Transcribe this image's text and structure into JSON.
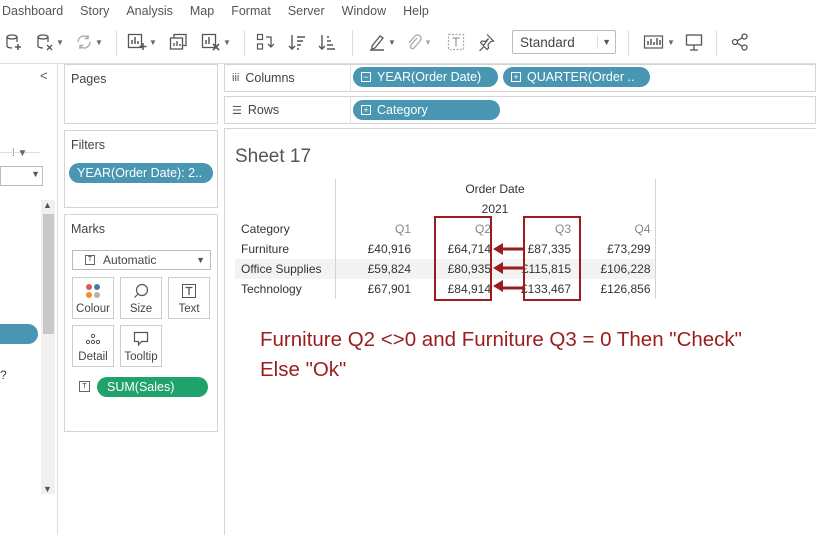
{
  "menu": [
    "Dashboard",
    "Story",
    "Analysis",
    "Map",
    "Format",
    "Server",
    "Window",
    "Help"
  ],
  "toolbar": {
    "fit_value": "Standard"
  },
  "panels": {
    "pages_title": "Pages",
    "filters_title": "Filters",
    "filter_pill": "YEAR(Order Date): 2..",
    "marks_title": "Marks",
    "mark_type": "Automatic",
    "mark_buttons": [
      "Colour",
      "Size",
      "Text",
      "Detail",
      "Tooltip"
    ],
    "sum_pill": "SUM(Sales)"
  },
  "left_pane": {
    "fragment": "?"
  },
  "shelves": {
    "columns_label": "Columns",
    "rows_label": "Rows",
    "columns_pills": [
      "YEAR(Order Date)",
      "QUARTER(Order .."
    ],
    "rows_pills": [
      "Category"
    ]
  },
  "sheet": {
    "title": "Sheet 17",
    "header_top": "Order Date",
    "header_year": "2021",
    "row_header_label": "Category",
    "quarters": [
      "Q1",
      "Q2",
      "Q3",
      "Q4"
    ],
    "rows": [
      {
        "category": "Furniture",
        "values": [
          "£40,916",
          "£64,714",
          "£87,335",
          "£73,299"
        ]
      },
      {
        "category": "Office Supplies",
        "values": [
          "£59,824",
          "£80,935",
          "£115,815",
          "£106,228"
        ]
      },
      {
        "category": "Technology",
        "values": [
          "£67,901",
          "£84,914",
          "£133,467",
          "£126,856"
        ]
      }
    ]
  },
  "annotation": {
    "line1": "Furniture Q2 <>0 and Furniture Q3 = 0 Then \"Check\"",
    "line2": "Else \"Ok\""
  },
  "colors": {
    "pill_blue": "#4996b2",
    "pill_green": "#1fa36b",
    "annotation_red": "#9a1c1c"
  }
}
